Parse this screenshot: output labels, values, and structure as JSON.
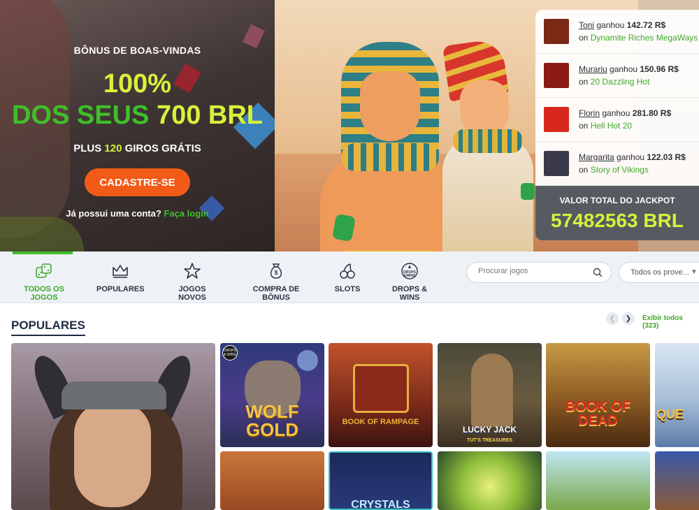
{
  "hero": {
    "kicker": "BÔNUS DE BOAS-VINDAS",
    "headline_line1": "100%",
    "headline_part1": "DOS SEUS",
    "headline_part2": "700 BRL",
    "sub_prefix": "PLUS",
    "sub_number": "120",
    "sub_suffix": "GIROS GRÁTIS",
    "cta_label": "CADASTRE-SE",
    "login_prompt": "Já possui uma conta?",
    "login_link": "Faça login"
  },
  "winners": [
    {
      "name": "Toni",
      "verb": "ganhou",
      "amount": "142.72 R$",
      "on": "on",
      "game": "Dynamite Riches MegaWays",
      "thumb_color": "#7a2a14"
    },
    {
      "name": "Murariu",
      "verb": "ganhou",
      "amount": "150.96 R$",
      "on": "on",
      "game": "20 Dazzling Hot",
      "thumb_color": "#8a1a14"
    },
    {
      "name": "Florin",
      "verb": "ganhou",
      "amount": "281.80 R$",
      "on": "on",
      "game": "Hell Hot 20",
      "thumb_color": "#d8281e"
    },
    {
      "name": "Margarita",
      "verb": "ganhou",
      "amount": "122.03 R$",
      "on": "on",
      "game": "Story of Vikings",
      "thumb_color": "#3a3a4a"
    }
  ],
  "jackpot": {
    "label": "VALOR TOTAL DO JACKPOT",
    "value": "57482563 BRL"
  },
  "nav": {
    "items": [
      {
        "label": "TODOS OS JOGOS",
        "icon": "dice-icon",
        "active": true
      },
      {
        "label": "POPULARES",
        "icon": "crown-icon",
        "active": false
      },
      {
        "label": "JOGOS NOVOS",
        "icon": "star-icon",
        "active": false
      },
      {
        "label": "COMPRA DE BÔNUS",
        "icon": "money-bag-icon",
        "active": false
      },
      {
        "label": "SLOTS",
        "icon": "cherries-icon",
        "active": false
      },
      {
        "label": "DROPS & WINS",
        "icon": "drops-wins-icon",
        "active": false
      }
    ],
    "search_placeholder": "Procurar jogos",
    "providers_label": "Todos os prove..."
  },
  "section": {
    "title": "POPULARES",
    "see_all": "Exibir todos (323)",
    "games": [
      {
        "title": ""
      },
      {
        "title": "WOLF GOLD",
        "badge": "DROPS & WINS"
      },
      {
        "title": "BOOK OF RAMPAGE"
      },
      {
        "title": "LUCKY JACK",
        "subtitle": "TUT'S TREASURES"
      },
      {
        "title": "BOOK OF DEAD"
      },
      {
        "title": "QUE"
      },
      {
        "title": ""
      },
      {
        "title": "CRYSTALS"
      },
      {
        "title": ""
      },
      {
        "title": ""
      },
      {
        "title": ""
      }
    ]
  },
  "colors": {
    "accent_green": "#3fbf2a",
    "accent_yellow": "#d7f23a",
    "cta_orange": "#f25a17",
    "navy": "#1f2a44"
  }
}
